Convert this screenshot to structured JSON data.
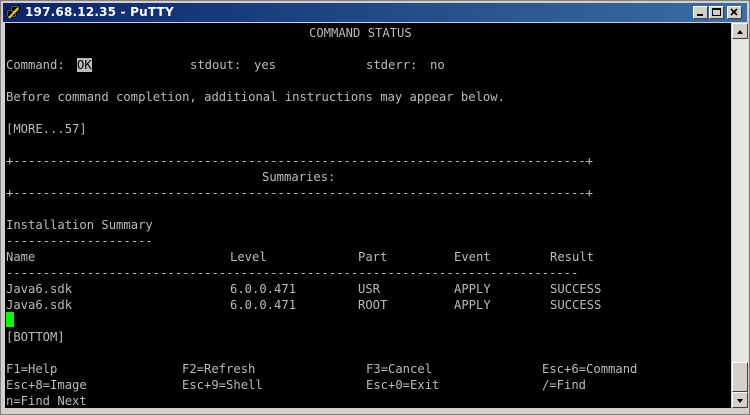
{
  "window": {
    "title": "197.68.12.35 - PuTTY",
    "icons": {
      "app": "putty-icon",
      "minimize": "minimize-icon",
      "maximize": "maximize-icon",
      "close": "close-icon"
    }
  },
  "terminal": {
    "header": "COMMAND STATUS",
    "command_label": "Command:",
    "command_value": "OK",
    "stdout_label": "stdout:",
    "stdout_value": "yes",
    "stderr_label": "stderr:",
    "stderr_value": "no",
    "instructions": "Before command completion, additional instructions may appear below.",
    "more": "[MORE...57]",
    "separator": "+------------------------------------------------------------------------------+",
    "summaries_title": "Summaries:",
    "installation_summary": "Installation Summary",
    "installation_underline": "--------------------",
    "columns": [
      "Name",
      "Level",
      "Part",
      "Event",
      "Result"
    ],
    "table_rule": "------------------------------------------------------------------------------",
    "rows": [
      {
        "name": "Java6.sdk",
        "level": "6.0.0.471",
        "part": "USR",
        "event": "APPLY",
        "result": "SUCCESS"
      },
      {
        "name": "Java6.sdk",
        "level": "6.0.0.471",
        "part": "ROOT",
        "event": "APPLY",
        "result": "SUCCESS"
      }
    ],
    "bottom": "[BOTTOM]",
    "function_keys": [
      [
        "F1=Help",
        "F2=Refresh",
        "F3=Cancel",
        "Esc+6=Command"
      ],
      [
        "Esc+8=Image",
        "Esc+9=Shell",
        "Esc+0=Exit",
        "/=Find"
      ],
      [
        "n=Find Next"
      ]
    ],
    "colors": {
      "background": "#000000",
      "foreground": "#bbbbbb",
      "cursor": "#00ff00"
    }
  }
}
